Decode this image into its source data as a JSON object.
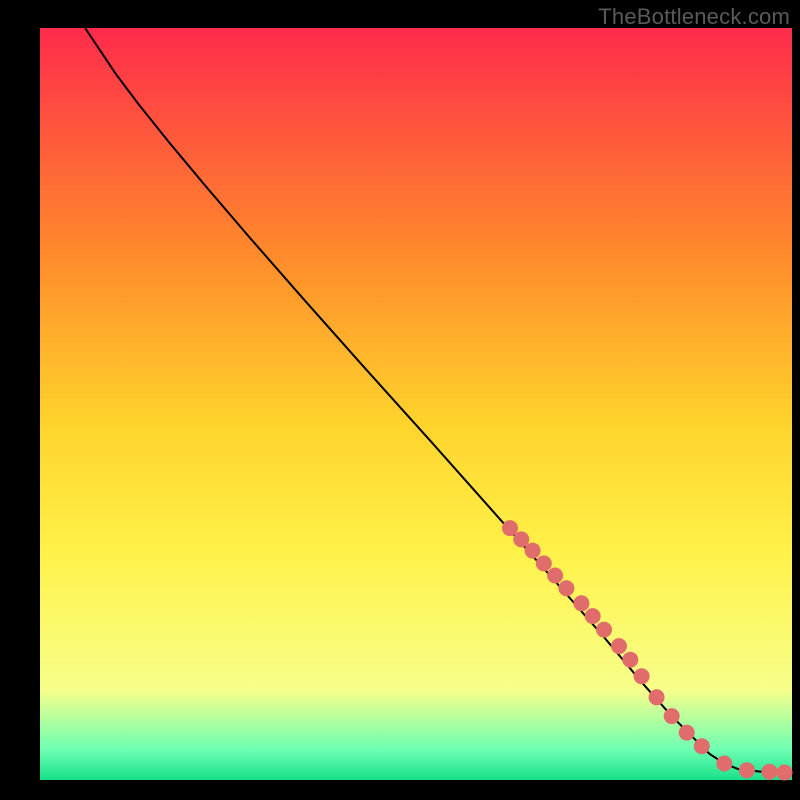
{
  "watermark": "TheBottleneck.com",
  "colors": {
    "gradient_top": "#ff2b4b",
    "gradient_mid1": "#ff8a2b",
    "gradient_mid2": "#ffd22b",
    "gradient_mid3": "#fff24a",
    "gradient_mid4": "#f7ff8a",
    "gradient_bottom1": "#6dffb3",
    "gradient_bottom2": "#18e08a",
    "curve": "#000000",
    "marker_fill": "#e06c6c",
    "marker_stroke": "#c94f4f"
  },
  "chart_data": {
    "type": "line",
    "title": "",
    "xlabel": "",
    "ylabel": "",
    "xlim": [
      0,
      100
    ],
    "ylim": [
      0,
      100
    ],
    "series": [
      {
        "name": "curve",
        "x": [
          6,
          8,
          10,
          13,
          17,
          22,
          28,
          35,
          43,
          52,
          60,
          68,
          75,
          80,
          84,
          87,
          89,
          91,
          93,
          96,
          100
        ],
        "y": [
          100,
          97,
          94,
          90,
          85,
          79,
          72,
          64,
          55,
          45,
          36,
          27,
          19,
          13,
          8.5,
          5.5,
          3.5,
          2.2,
          1.4,
          1.1,
          1.0
        ]
      }
    ],
    "markers": {
      "name": "highlighted-points",
      "x": [
        62.5,
        64,
        65.5,
        67,
        68.5,
        70,
        72,
        73.5,
        75,
        77,
        78.5,
        80,
        82,
        84,
        86,
        88,
        91,
        94,
        97,
        99
      ],
      "y": [
        33.5,
        32,
        30.5,
        28.8,
        27.2,
        25.5,
        23.5,
        21.8,
        20,
        17.8,
        16,
        13.8,
        11,
        8.5,
        6.3,
        4.5,
        2.2,
        1.3,
        1.1,
        1.0
      ]
    },
    "gradient_band_y": [
      0,
      100
    ]
  }
}
